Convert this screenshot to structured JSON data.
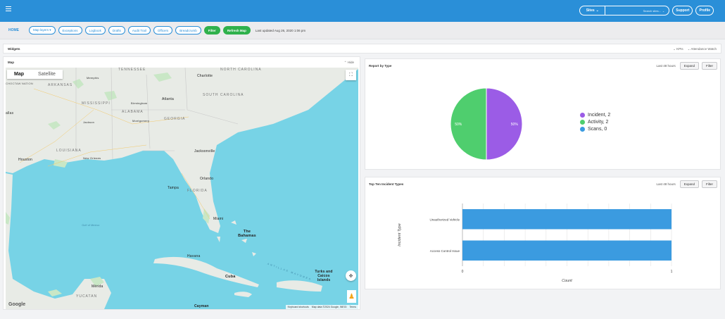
{
  "topbar": {
    "menu_icon": "hamburger-icon",
    "site_select_label": "Sites",
    "site_search_placeholder": "Search sites...",
    "support_label": "Support",
    "profile_label": "Profile",
    "accent": "#2a8fd8"
  },
  "toolbar": {
    "home_label": "HOME",
    "map_layers_label": "Map layers ▾",
    "exceptions_label": "Exceptions",
    "logbook_label": "Logbook",
    "drafts_label": "Drafts",
    "audit_trail_label": "Audit Trail",
    "officers_label": "Officers",
    "breadcrumb_label": "Breadcrumb",
    "filter_label": "Filter",
    "refresh_label": "Refresh Map",
    "updated_text": "Last updated Aug 26, 2020 1:06 pm",
    "green": "#2fb14c"
  },
  "widgets": {
    "title": "Widgets",
    "kpis_label": "KPIs",
    "attendance_label": "Attendance Watch"
  },
  "map": {
    "title": "Map",
    "hide_label": "Hide",
    "map_type_map": "Map",
    "map_type_satellite": "Satellite",
    "google_logo": "Google",
    "attribution": {
      "shortcuts": "Keyboard shortcuts",
      "data": "Map data ©2024 Google, INEGI",
      "terms": "Terms"
    },
    "labels": {
      "tennessee": "TENNESSEE",
      "north_carolina": "NORTH CAROLINA",
      "south_carolina": "SOUTH CAROLINA",
      "arkansas": "ARKANSAS",
      "choctaw": "CHOCTAW NATION",
      "mississippi": "MISSISSIPPI",
      "alabama": "ALABAMA",
      "georgia": "GEORGIA",
      "louisiana": "LOUISIANA",
      "florida": "FLORIDA",
      "yucatan": "YUCATAN",
      "memphis": "Memphis",
      "charlotte": "Charlotte",
      "atlanta": "Atlanta",
      "birmingham": "Birmingham",
      "jackson": "Jackson",
      "montgomery": "Montgomery",
      "jacksonville": "Jacksonville",
      "new_orleans": "New Orleans",
      "houston": "Houston",
      "tampa": "Tampa",
      "orlando": "Orlando",
      "miami": "Miami",
      "havana": "Havana",
      "cuba": "Cuba",
      "bahamas": "The Bahamas",
      "turks": "Turks and Caicos Islands",
      "merida": "Mérida",
      "cayman": "Cayman",
      "dallas": "allas",
      "gulf": "Gulf of Mexico",
      "antilles": "ANTILLAS MAYORES"
    }
  },
  "report_by_type": {
    "title": "Report by Type",
    "period": "Last 48 hours",
    "expand_label": "Expand",
    "filter_label": "Filter"
  },
  "top_ten": {
    "title": "Top Ten Incident Types",
    "period": "Last 48 hours",
    "expand_label": "Expand",
    "filter_label": "Filter"
  },
  "chart_data": [
    {
      "type": "pie",
      "title": "Report by Type",
      "categories": [
        "Incident",
        "Activity",
        "Scans"
      ],
      "values": [
        2,
        2,
        0
      ],
      "slice_labels": [
        "50%",
        "50%"
      ],
      "legend_entries": [
        "Incident, 2",
        "Activity, 2",
        "Scans, 0"
      ],
      "colors": [
        "#9b5ce6",
        "#4fce6e",
        "#3b9be0"
      ],
      "legend_position": "right"
    },
    {
      "type": "bar",
      "orientation": "horizontal",
      "title": "Top Ten Incident Types",
      "categories": [
        "Unauthorized Vehicle",
        "Access Control Issue"
      ],
      "values": [
        1,
        1
      ],
      "xlabel": "Count",
      "ylabel": "Incident Type",
      "xlim": [
        0,
        1
      ],
      "x_ticks": [
        "0",
        "1"
      ],
      "color": "#3b9be0",
      "grid": true
    }
  ]
}
